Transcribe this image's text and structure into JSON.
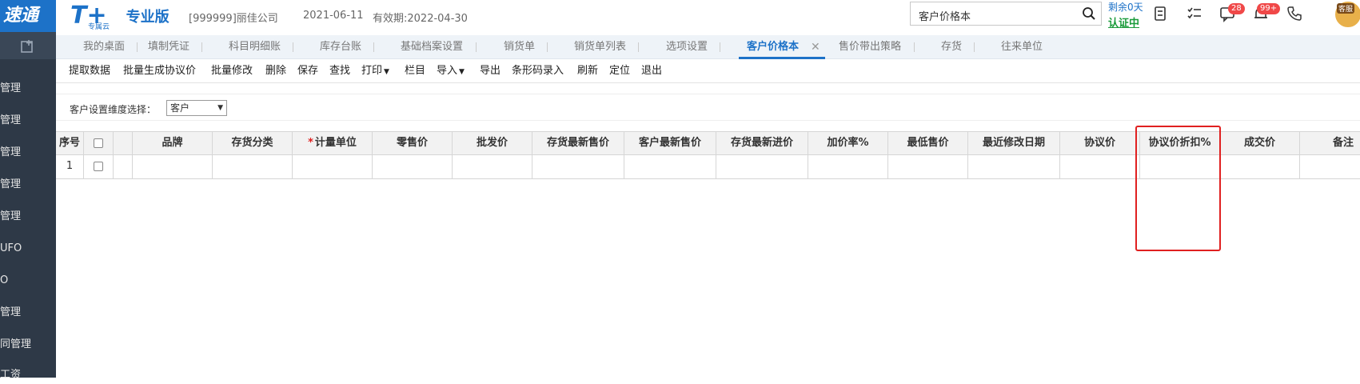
{
  "header": {
    "logo_text": "速通",
    "brand_t": "T+",
    "brand_sub": "专属云",
    "brand_name": "专业版",
    "company": "[999999]丽佳公司",
    "date": "2021-06-11",
    "expiry": "有效期:2022-04-30",
    "search_value": "客户价格本",
    "remain_days": "剩余0天",
    "cert_status": "认证中",
    "msg_badge": "28",
    "notify_badge": "99+",
    "avatar_label": "客服"
  },
  "sidebar": {
    "items": [
      "管理",
      "管理",
      "管理",
      "管理",
      "管理",
      "UFO",
      "O",
      "管理",
      "同管理",
      "工资"
    ]
  },
  "tabs": [
    {
      "label": "我的桌面"
    },
    {
      "label": "填制凭证"
    },
    {
      "label": "科目明细账"
    },
    {
      "label": "库存台账"
    },
    {
      "label": "基础档案设置"
    },
    {
      "label": "销货单"
    },
    {
      "label": "销货单列表"
    },
    {
      "label": "选项设置"
    },
    {
      "label": "客户价格本"
    },
    {
      "label": "售价带出策略"
    },
    {
      "label": "存货"
    },
    {
      "label": "往来单位"
    }
  ],
  "toolbar": {
    "items": [
      "提取数据",
      "批量生成协议价",
      "批量修改",
      "删除",
      "保存",
      "查找",
      "打印",
      "栏目",
      "导入",
      "导出",
      "条形码录入",
      "刷新",
      "定位",
      "退出"
    ]
  },
  "filter": {
    "label": "客户设置维度选择：",
    "value": "客户"
  },
  "grid": {
    "columns": [
      "序号",
      "",
      "",
      "品牌",
      "存货分类",
      "计量单位",
      "零售价",
      "批发价",
      "存货最新售价",
      "客户最新售价",
      "存货最新进价",
      "加价率%",
      "最低售价",
      "最近修改日期",
      "协议价",
      "协议价折扣%",
      "成交价",
      "备注"
    ],
    "rows": [
      [
        "1",
        "",
        "",
        "",
        "",
        "",
        "",
        "",
        "",
        "",
        "",
        "",
        "",
        "",
        "",
        "",
        "",
        ""
      ]
    ]
  },
  "colors": {
    "accent": "#1d72c8",
    "highlight": "#e02020"
  }
}
